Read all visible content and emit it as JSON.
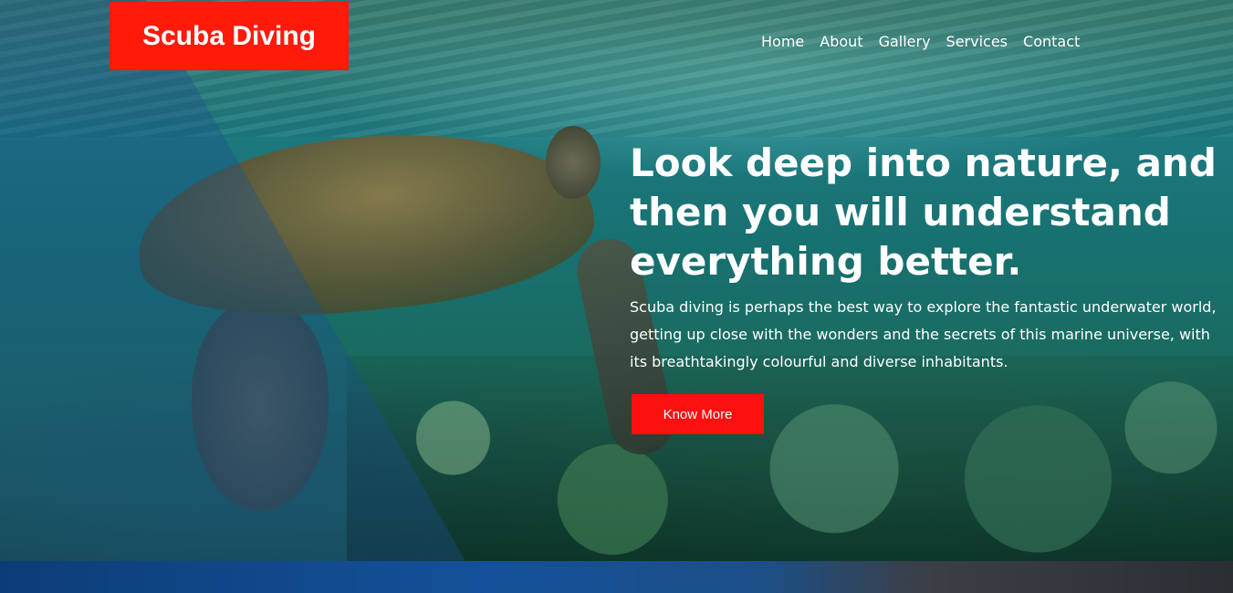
{
  "brand": {
    "name": "Scuba Diving",
    "accent_color": "#ff1a0a"
  },
  "nav": {
    "items": [
      {
        "label": "Home"
      },
      {
        "label": "About"
      },
      {
        "label": "Gallery"
      },
      {
        "label": "Services"
      },
      {
        "label": "Contact"
      }
    ]
  },
  "hero": {
    "headline": "Look deep into nature, and then you will understand everything better.",
    "description": "Scuba diving is perhaps the best way to explore the fantastic underwater world, getting up close with the wonders and the secrets of this marine universe, with its breathtakingly colourful and diverse inhabitants.",
    "cta_label": "Know More",
    "background_image": "sea-turtle-underwater"
  }
}
